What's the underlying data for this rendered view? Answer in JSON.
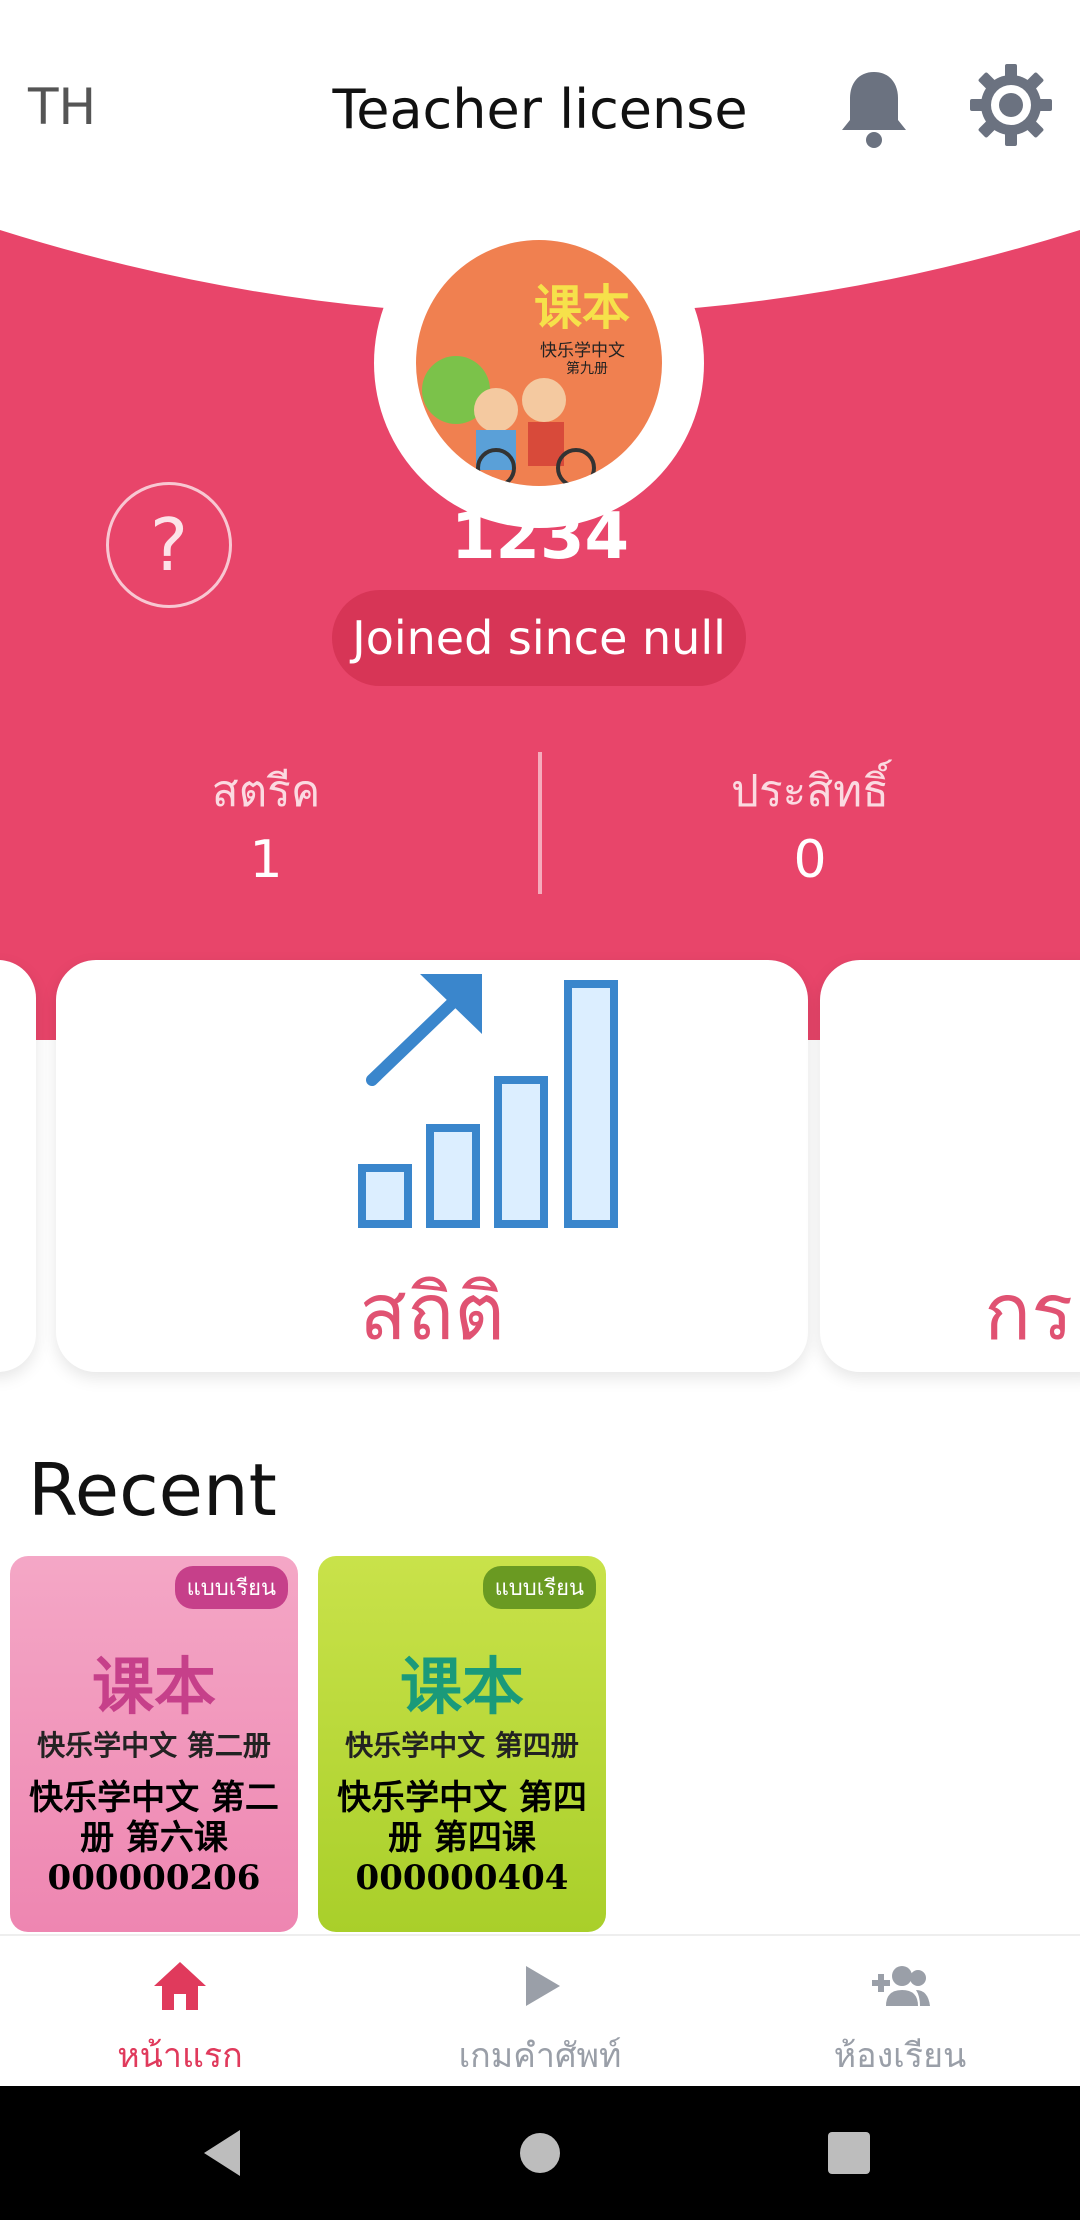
{
  "header": {
    "language": "TH",
    "title": "Teacher license"
  },
  "profile": {
    "id": "1234",
    "joined": "Joined since null",
    "avatar_cover": {
      "title": "课本",
      "subtitle": "快乐学中文",
      "volume": "第九册"
    }
  },
  "stats": [
    {
      "label": "สตรีค",
      "value": "1"
    },
    {
      "label": "ประสิทธิ์",
      "value": "0"
    }
  ],
  "cards": {
    "main_label": "สถิติ",
    "next_label": "กร"
  },
  "recent": {
    "title": "Recent",
    "books": [
      {
        "badge": "แบบเรียน",
        "cover_title": "课本",
        "cover_sub": "快乐学中文 第二册",
        "caption": "快乐学中文 第二册 第六课 000000206"
      },
      {
        "badge": "แบบเรียน",
        "cover_title": "课本",
        "cover_sub": "快乐学中文 第四册",
        "caption": "快乐学中文 第四册 第四课 000000404"
      }
    ]
  },
  "nav": {
    "home": "หน้าแรก",
    "game": "เกมคำศัพท์",
    "classroom": "ห้องเรียน"
  },
  "colors": {
    "accent": "#e8456a",
    "nav_active": "#e03a5c",
    "nav_inactive": "#9a9fa8",
    "chart_icon": "#3a86cc"
  }
}
